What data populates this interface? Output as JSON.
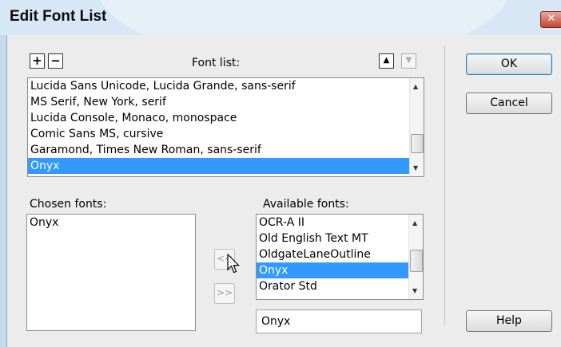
{
  "dialog": {
    "title": "Edit Font List",
    "close_glyph": "✕"
  },
  "toolbar": {
    "add_glyph": "+",
    "remove_glyph": "−",
    "up_glyph": "▲",
    "down_glyph": "▼"
  },
  "font_list": {
    "label": "Font list:",
    "items": [
      "Lucida Sans Unicode, Lucida Grande, sans-serif",
      "MS Serif, New York, serif",
      "Lucida Console, Monaco, monospace",
      "Comic Sans MS, cursive",
      "Garamond, Times New Roman, sans-serif",
      "Onyx"
    ],
    "selected": "Onyx"
  },
  "chosen_fonts": {
    "label": "Chosen fonts:",
    "items": [
      "Onyx"
    ]
  },
  "available_fonts": {
    "label": "Available fonts:",
    "items": [
      "OCR-A II",
      "Old English Text MT",
      "OldgateLaneOutline",
      "Onyx",
      "Orator Std"
    ],
    "selected": "Onyx",
    "input_value": "Onyx"
  },
  "transfer": {
    "add_label": "<<",
    "remove_label": ">>"
  },
  "buttons": {
    "ok": "OK",
    "cancel": "Cancel",
    "help": "Help"
  }
}
